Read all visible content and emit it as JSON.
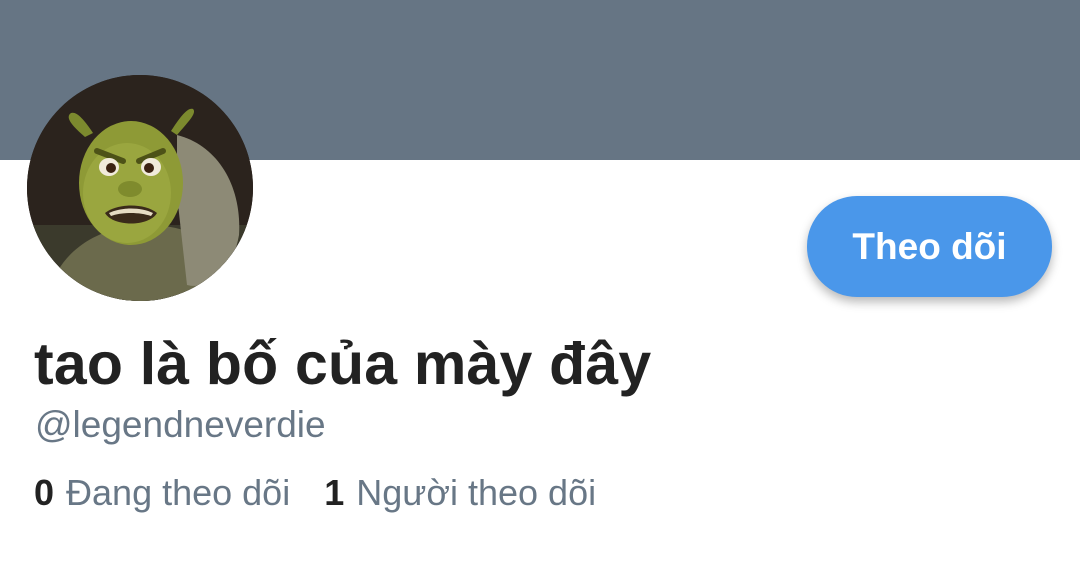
{
  "profile": {
    "display_name": "tao là bố của mày đây",
    "handle": "@legendneverdie",
    "follow_label": "Theo dõi",
    "following": {
      "count": "0",
      "label": "Đang theo dõi"
    },
    "followers": {
      "count": "1",
      "label": "Người theo dõi"
    }
  },
  "colors": {
    "banner": "#667584",
    "follow_button": "#4a97ea",
    "secondary_text": "#687786",
    "primary_text": "#222222"
  }
}
